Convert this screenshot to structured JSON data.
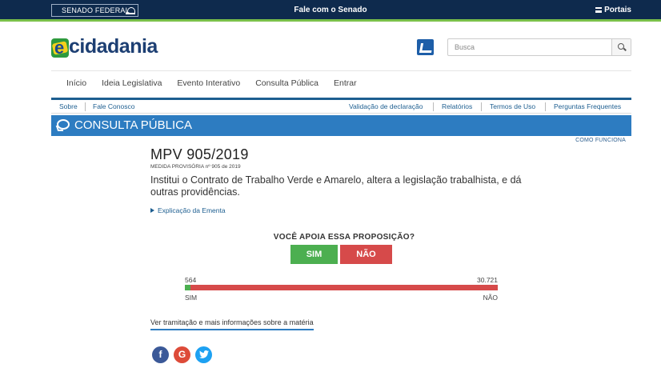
{
  "topbar": {
    "senado_label": "SENADO FEDERAL",
    "fale_label": "Fale com o Senado",
    "portais_label": "Portais"
  },
  "header": {
    "logo_text": "cidadania",
    "search_placeholder": "Busca"
  },
  "main_nav": {
    "items": [
      "Início",
      "Ideia Legislativa",
      "Evento Interativo",
      "Consulta Pública",
      "Entrar"
    ]
  },
  "sub_nav": {
    "left": [
      "Sobre",
      "Fale Conosco"
    ],
    "right": [
      "Validação de declaração",
      "Relatórios",
      "Termos de Uso",
      "Perguntas Frequentes"
    ]
  },
  "banner": {
    "title": "CONSULTA PÚBLICA",
    "como_funciona": "COMO FUNCIONA"
  },
  "proposal": {
    "title": "MPV 905/2019",
    "subtitle": "MEDIDA PROVISÓRIA nº 905 de 2019",
    "ementa": "Institui o Contrato de Trabalho Verde e Amarelo, altera a legislação trabalhista, e dá outras providências.",
    "explicacao": "Explicação da Ementa"
  },
  "vote": {
    "question": "VOCÊ APOIA ESSA PROPOSIÇÃO?",
    "yes_label": "SIM",
    "no_label": "NÃO",
    "yes_count": "564",
    "no_count": "30.721",
    "yes_fraction": 0.018,
    "yes_color": "#4caf50",
    "no_color": "#d64a4a"
  },
  "footer": {
    "tramitacao_link": "Ver tramitação e mais informações sobre a matéria"
  },
  "social": [
    "facebook-icon",
    "google-plus-icon",
    "twitter-icon"
  ]
}
